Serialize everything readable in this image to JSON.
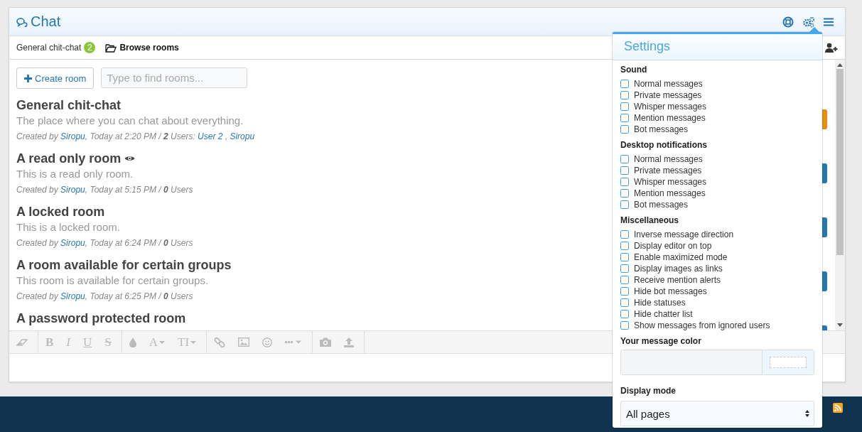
{
  "window": {
    "title": "Chat"
  },
  "tabs": [
    {
      "kind": "room",
      "label": "General chit-chat",
      "badge": "2",
      "selected": false
    },
    {
      "kind": "browse",
      "label": "Browse rooms",
      "selected": true
    }
  ],
  "actions": {
    "create": "Create room",
    "search_placeholder": "Type to find rooms..."
  },
  "rooms": [
    {
      "title": "General chit-chat",
      "description": "The place where you can chat about everything.",
      "meta": [
        {
          "kind": "text",
          "text": "Created by "
        },
        {
          "kind": "link",
          "text": "Siropu"
        },
        {
          "kind": "text",
          "text": ", Today at 2:20 PM / "
        },
        {
          "kind": "bold",
          "text": "2"
        },
        {
          "kind": "text",
          "text": " Users: "
        },
        {
          "kind": "link",
          "text": "User 2"
        },
        {
          "kind": "text",
          "text": " , "
        },
        {
          "kind": "link",
          "text": "Siropu"
        }
      ]
    },
    {
      "title": "A read only room",
      "kind": "readonly",
      "description": "This is a read only room.",
      "meta": [
        {
          "kind": "text",
          "text": "Created by "
        },
        {
          "kind": "link",
          "text": "Siropu"
        },
        {
          "kind": "text",
          "text": ", Today at 5:15 PM / "
        },
        {
          "kind": "bold",
          "text": "0"
        },
        {
          "kind": "text",
          "text": " Users"
        }
      ]
    },
    {
      "title": "A locked room",
      "description": "This is a locked room.",
      "meta": [
        {
          "kind": "text",
          "text": "Created by "
        },
        {
          "kind": "link",
          "text": "Siropu"
        },
        {
          "kind": "text",
          "text": ", Today at 6:24 PM / "
        },
        {
          "kind": "bold",
          "text": "0"
        },
        {
          "kind": "text",
          "text": " Users"
        }
      ]
    },
    {
      "title": "A room available for certain groups",
      "description": "This room is available for certain groups.",
      "meta": [
        {
          "kind": "text",
          "text": "Created by "
        },
        {
          "kind": "link",
          "text": "Siropu"
        },
        {
          "kind": "text",
          "text": ", Today at 6:25 PM / "
        },
        {
          "kind": "bold",
          "text": "0"
        },
        {
          "kind": "text",
          "text": " Users"
        }
      ]
    },
    {
      "title": "A password protected room"
    }
  ],
  "room_buttons": [
    {
      "color": "#e8900c"
    },
    {
      "color": "#2577b1"
    },
    {
      "color": "#2577b1"
    },
    {
      "color": "#2577b1"
    },
    {
      "color": "#2577b1"
    }
  ],
  "toolbar": [
    [
      {
        "kind": "eraser"
      }
    ],
    [
      {
        "kind": "bold",
        "glyph": "B"
      },
      {
        "kind": "italic",
        "glyph": "I"
      },
      {
        "kind": "underline",
        "glyph": "U"
      },
      {
        "kind": "strike",
        "glyph": "S"
      }
    ],
    [
      {
        "kind": "drop"
      },
      {
        "kind": "dropdown",
        "glyph": "A"
      },
      {
        "kind": "dropdown",
        "glyph": "TI"
      }
    ],
    [
      {
        "kind": "link"
      },
      {
        "kind": "image"
      },
      {
        "kind": "smiley"
      },
      {
        "kind": "dots"
      }
    ],
    [
      {
        "kind": "camera"
      },
      {
        "kind": "upload"
      }
    ]
  ],
  "settings": {
    "title": "Settings",
    "sections": [
      {
        "title": "Sound",
        "items": [
          {
            "label": "Normal messages",
            "checked": false
          },
          {
            "label": "Private messages",
            "checked": false
          },
          {
            "label": "Whisper messages",
            "checked": false
          },
          {
            "label": "Mention messages",
            "checked": false
          },
          {
            "label": "Bot messages",
            "checked": false
          }
        ]
      },
      {
        "title": "Desktop notifications",
        "items": [
          {
            "label": "Normal messages",
            "checked": false
          },
          {
            "label": "Private messages",
            "checked": false
          },
          {
            "label": "Whisper messages",
            "checked": false
          },
          {
            "label": "Mention messages",
            "checked": false
          },
          {
            "label": "Bot messages",
            "checked": false
          }
        ]
      },
      {
        "title": "Miscellaneous",
        "items": [
          {
            "label": "Inverse message direction",
            "checked": false
          },
          {
            "label": "Display editor on top",
            "checked": false
          },
          {
            "label": "Enable maximized mode",
            "checked": false
          },
          {
            "label": "Display images as links",
            "checked": false
          },
          {
            "label": "Receive mention alerts",
            "checked": false
          },
          {
            "label": "Hide bot messages",
            "checked": false
          },
          {
            "label": "Hide statuses",
            "checked": false
          },
          {
            "label": "Hide chatter list",
            "checked": false
          },
          {
            "label": "Show messages from ignored users",
            "checked": false
          }
        ]
      }
    ],
    "color_label": "Your message color",
    "display_label": "Display mode",
    "display_value": "All pages"
  }
}
